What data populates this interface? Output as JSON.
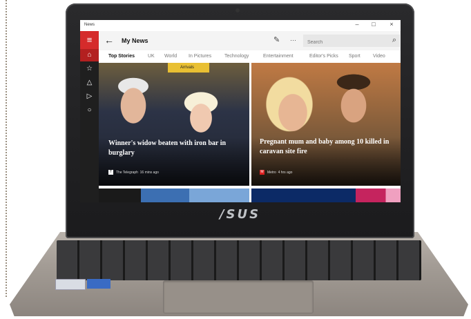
{
  "window": {
    "title": "News"
  },
  "brand": "/SUS",
  "header": {
    "title": "My News",
    "back_icon": "arrow-left-icon",
    "edit_icon": "pencil-icon",
    "more_icon": "ellipsis-icon"
  },
  "search": {
    "placeholder": "Search",
    "icon": "search-icon"
  },
  "sidebar": {
    "items": [
      "menu-icon",
      "home-icon",
      "interests-icon",
      "local-icon",
      "video-icon",
      "chat-icon"
    ]
  },
  "tabs": [
    "Top Stories",
    "UK",
    "World",
    "In Pictures",
    "Technology",
    "Entertainment",
    "Editor's Picks",
    "Sport",
    "Video"
  ],
  "cards": [
    {
      "headline": "Winner's widow beaten with iron bar in burglary",
      "source": "The Telegraph",
      "time": "16 mins ago",
      "sign": "Arrivals"
    },
    {
      "headline": "Pregnant mum and baby among 10 killed in caravan site fire",
      "source": "Metro",
      "time": "4 hrs ago"
    }
  ],
  "colors": {
    "accent": "#d52b2b",
    "sidebar": "#1f1f1f"
  }
}
